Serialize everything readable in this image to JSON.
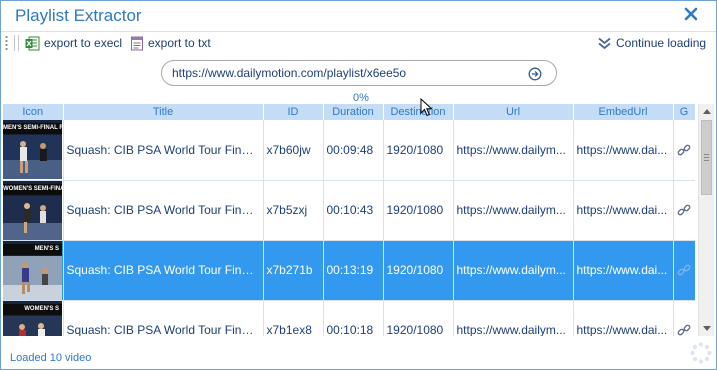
{
  "window": {
    "title": "Playlist Extractor",
    "accent_color": "#2f79c5",
    "selection_color": "#3399ee"
  },
  "toolbar": {
    "export_excel_label": "export to execl",
    "export_excel_icon": "excel-file-icon",
    "export_txt_label": "export to txt",
    "export_txt_icon": "text-file-icon",
    "continue_label": "Continue loading",
    "continue_icon": "double-chevron-down-icon"
  },
  "url_bar": {
    "value": "https://www.dailymotion.com/playlist/x6ee5o",
    "go_icon": "arrow-right-circle-icon"
  },
  "progress": {
    "text": "0%",
    "value": 0
  },
  "table": {
    "columns": [
      "Icon",
      "Title",
      "ID",
      "Duration",
      "Destination",
      "Url",
      "EmbedUrl",
      "G"
    ],
    "rows": [
      {
        "thumb_banner": "MEN'S SEMI-FINAL R",
        "title": "Squash: CIB PSA World Tour Finals 2...",
        "id": "x7b60jw",
        "duration": "00:09:48",
        "destination": "1920/1080",
        "url": "https://www.dailym...",
        "embed_url": "https://www.dai...",
        "selected": false
      },
      {
        "thumb_banner": "WOMEN'S SEMI-FINAL",
        "title": "Squash: CIB PSA World Tour Finals 2...",
        "id": "x7b5zxj",
        "duration": "00:10:43",
        "destination": "1920/1080",
        "url": "https://www.dailym...",
        "embed_url": "https://www.dai...",
        "selected": false
      },
      {
        "thumb_banner": "MEN'S S",
        "title": "Squash: CIB PSA World Tour Finals 2...",
        "id": "x7b271b",
        "duration": "00:13:19",
        "destination": "1920/1080",
        "url": "https://www.dailym...",
        "embed_url": "https://www.dai...",
        "selected": true
      },
      {
        "thumb_banner": "WOMEN'S S",
        "title": "Squash: CIB PSA World Tour Finals 2...",
        "id": "x7b1ex8",
        "duration": "00:10:18",
        "destination": "1920/1080",
        "url": "https://www.dailym...",
        "embed_url": "https://www.dai...",
        "selected": false
      }
    ],
    "link_icon": "chain-link-icon"
  },
  "status": {
    "text": "Loaded 10 video",
    "spinner_icon": "loading-spinner-icon"
  }
}
